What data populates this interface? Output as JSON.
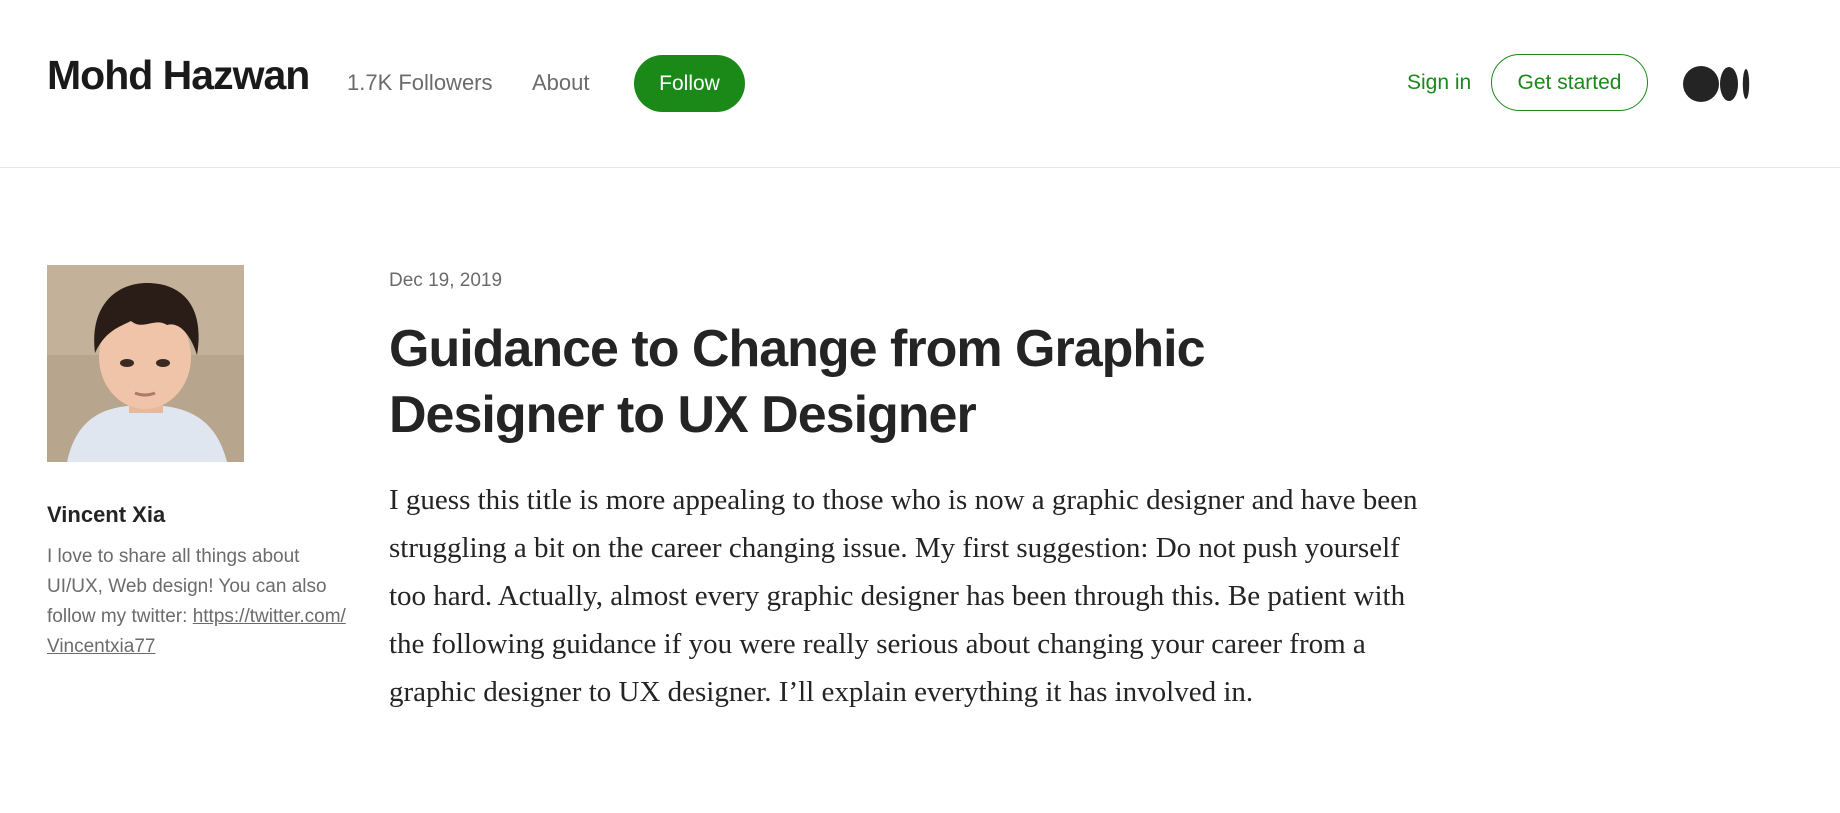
{
  "header": {
    "publication_name": "Mohd Hazwan",
    "followers_label": "1.7K Followers",
    "about_label": "About",
    "follow_label": "Follow",
    "signin_label": "Sign in",
    "get_started_label": "Get started",
    "logo_icon": "medium-logo-icon"
  },
  "author": {
    "name": "Vincent Xia",
    "bio_text": "I love to share all things about UI/UX, Web design! You can also follow my twitter: ",
    "twitter_link": "https://twitter.com/Vincentxia77",
    "avatar_icon": "author-avatar-photo"
  },
  "post": {
    "date": "Dec 19, 2019",
    "title": "Guidance to Change from Graphic Designer to UX Designer",
    "body": "I guess this title is more appealing to those who is now a graphic designer and have been struggling a bit on the career changing issue. My first suggestion: Do not push yourself too hard. Actually, almost every graphic designer has been through this. Be patient with the following guidance if you were really serious about changing your career from a graphic designer to UX designer. I’ll explain everything it has involved in."
  },
  "colors": {
    "accent_green": "#1a8917",
    "text_primary": "#242424",
    "text_secondary": "#6b6b6b",
    "divider": "#e6e6e6"
  }
}
